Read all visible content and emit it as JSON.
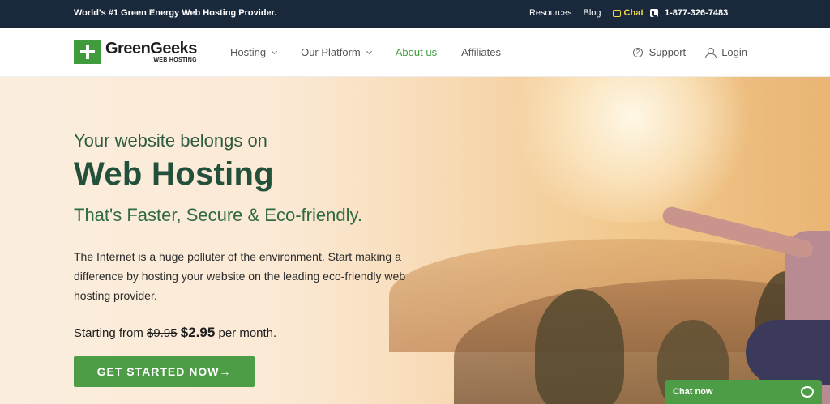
{
  "topbar": {
    "tagline": "World's #1 Green Energy Web Hosting Provider.",
    "links": [
      "Resources",
      "Blog"
    ],
    "chat_label": "Chat",
    "phone": "1-877-326-7483"
  },
  "logo": {
    "name": "GreenGeeks",
    "subtitle": "WEB HOSTING"
  },
  "nav": {
    "items": [
      {
        "label": "Hosting"
      },
      {
        "label": "Our Platform"
      },
      {
        "label": "About us"
      },
      {
        "label": "Affiliates"
      }
    ],
    "support_label": "Support",
    "login_label": "Login"
  },
  "hero": {
    "pre_title": "Your website belongs on",
    "title": "Web Hosting",
    "subtitle": "That's Faster, Secure & Eco-friendly.",
    "description": "The Internet is a huge polluter of the environment. Start making a difference by hosting your website on the leading eco-friendly web hosting provider.",
    "price_prefix": "Starting from",
    "price_old": "$9.95",
    "price_new": "$2.95",
    "price_suffix": "per month.",
    "cta_label": "GET STARTED NOW→"
  },
  "chat_widget": {
    "label": "Chat now"
  },
  "colors": {
    "topbar_bg": "#19283a",
    "brand_green": "#4d9d46",
    "heading_green": "#23503a",
    "chat_yellow": "#f3d84b"
  }
}
